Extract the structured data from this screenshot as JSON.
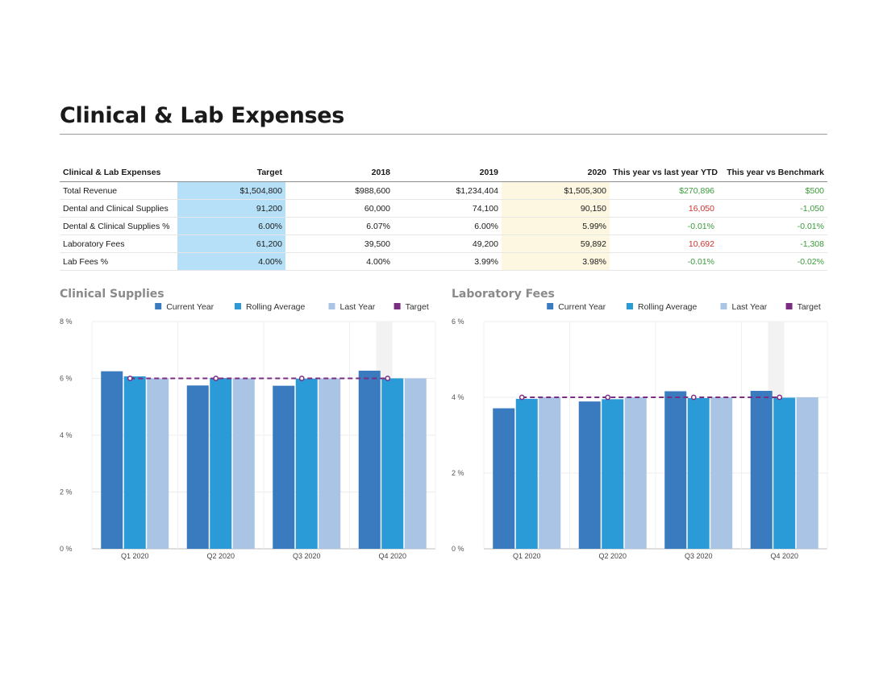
{
  "page": {
    "title": "Clinical & Lab Expenses"
  },
  "table": {
    "headers": [
      "Clinical & Lab Expenses",
      "Target",
      "2018",
      "2019",
      "2020",
      "This year vs last year YTD",
      "This year vs Benchmark"
    ],
    "rows": [
      {
        "label": "Total Revenue",
        "target": "$1,504,800",
        "y2018": "$988,600",
        "y2019": "$1,234,404",
        "y2020": "$1,505,300",
        "vs_last": "$270,896",
        "vs_last_status": "pos",
        "vs_bench": "$500",
        "vs_bench_status": "pos"
      },
      {
        "label": "Dental and Clinical Supplies",
        "target": "91,200",
        "y2018": "60,000",
        "y2019": "74,100",
        "y2020": "90,150",
        "vs_last": "16,050",
        "vs_last_status": "neg",
        "vs_bench": "-1,050",
        "vs_bench_status": "pos"
      },
      {
        "label": "Dental & Clinical Supplies %",
        "target": "6.00%",
        "y2018": "6.07%",
        "y2019": "6.00%",
        "y2020": "5.99%",
        "vs_last": "-0.01%",
        "vs_last_status": "pos",
        "vs_bench": "-0.01%",
        "vs_bench_status": "pos"
      },
      {
        "label": "Laboratory Fees",
        "target": "61,200",
        "y2018": "39,500",
        "y2019": "49,200",
        "y2020": "59,892",
        "vs_last": "10,692",
        "vs_last_status": "neg",
        "vs_bench": "-1,308",
        "vs_bench_status": "pos"
      },
      {
        "label": "Lab Fees %",
        "target": "4.00%",
        "y2018": "4.00%",
        "y2019": "3.99%",
        "y2020": "3.98%",
        "vs_last": "-0.01%",
        "vs_last_status": "pos",
        "vs_bench": "-0.02%",
        "vs_bench_status": "pos"
      }
    ]
  },
  "colors": {
    "current_year": "#3a7bbf",
    "rolling_average": "#2a9bd6",
    "last_year": "#a9c4e4",
    "target": "#7b2c83",
    "positive": "#3a9a3a",
    "negative": "#cc3030",
    "target_column_bg": "#b6e0f7",
    "year_2020_bg": "#fdf7e1"
  },
  "chart_data": [
    {
      "type": "bar",
      "title": "Clinical Supplies",
      "categories": [
        "Q1 2020",
        "Q2 2020",
        "Q3 2020",
        "Q4 2020"
      ],
      "series": [
        {
          "name": "Current Year",
          "values": [
            6.25,
            5.75,
            5.74,
            6.27
          ]
        },
        {
          "name": "Rolling Average",
          "values": [
            6.07,
            6.01,
            5.99,
            6.0
          ]
        },
        {
          "name": "Last Year",
          "values": [
            6.0,
            6.0,
            6.0,
            6.0
          ]
        },
        {
          "name": "Target",
          "type": "line",
          "style": "dashed",
          "values": [
            6.0,
            6.0,
            6.0,
            6.0
          ]
        }
      ],
      "ylim": [
        0,
        8
      ],
      "yticks": [
        "0 %",
        "2 %",
        "4 %",
        "6 %",
        "8 %"
      ],
      "ytick_values": [
        0,
        2,
        4,
        6,
        8
      ],
      "legend": "top-right",
      "grid": true
    },
    {
      "type": "bar",
      "title": "Laboratory Fees",
      "categories": [
        "Q1 2020",
        "Q2 2020",
        "Q3 2020",
        "Q4 2020"
      ],
      "series": [
        {
          "name": "Current Year",
          "values": [
            3.71,
            3.89,
            4.16,
            4.17
          ]
        },
        {
          "name": "Rolling Average",
          "values": [
            3.96,
            3.95,
            3.98,
            3.99
          ]
        },
        {
          "name": "Last Year",
          "values": [
            4.0,
            4.0,
            4.0,
            4.0
          ]
        },
        {
          "name": "Target",
          "type": "line",
          "style": "dashed",
          "values": [
            4.0,
            4.0,
            4.0,
            4.0
          ]
        }
      ],
      "ylim": [
        0,
        6
      ],
      "yticks": [
        "0 %",
        "2 %",
        "4 %",
        "6 %"
      ],
      "ytick_values": [
        0,
        2,
        4,
        6
      ],
      "legend": "top-right",
      "grid": true
    }
  ]
}
